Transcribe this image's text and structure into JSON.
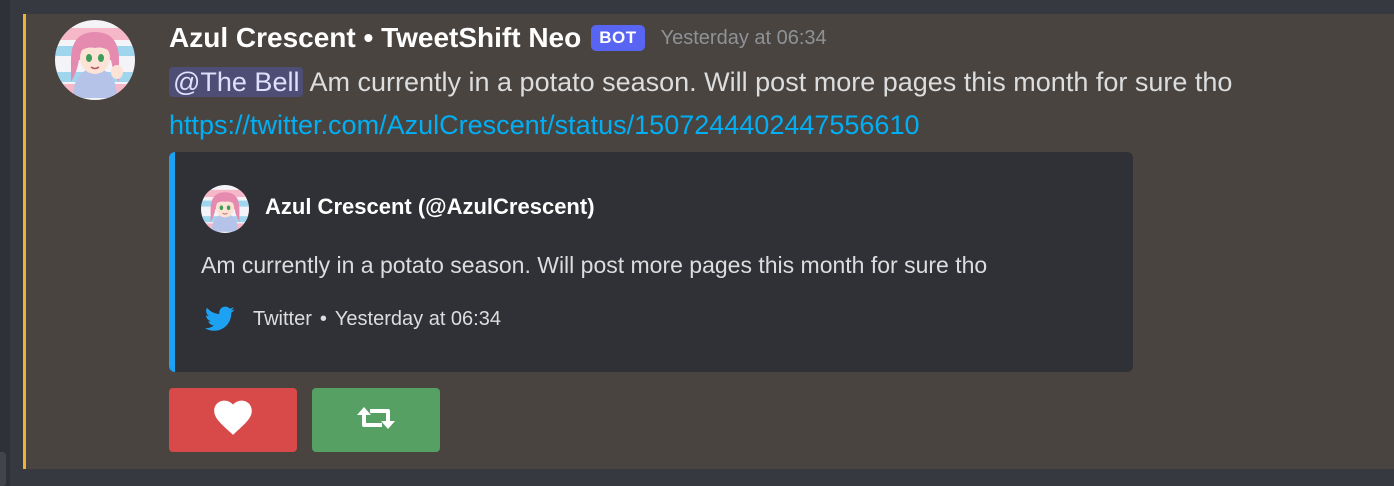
{
  "message": {
    "username": "Azul Crescent • TweetShift Neo",
    "bot_tag": "BOT",
    "timestamp": "Yesterday at 06:34",
    "mention": "@The Bell",
    "text": " Am currently in a potato season. Will post more pages this month for sure tho",
    "link": "https://twitter.com/AzulCrescent/status/1507244402447556610"
  },
  "embed": {
    "author": "Azul Crescent (@AzulCrescent)",
    "description": "Am currently in a potato season. Will post more pages this month for sure tho",
    "footer_source": "Twitter",
    "footer_separator": "•",
    "footer_time": "Yesterday at 06:34",
    "footer_icon": "twitter-bird-icon"
  },
  "buttons": {
    "like_icon": "heart-icon",
    "retweet_icon": "retweet-icon"
  },
  "colors": {
    "highlight": "#f0b232",
    "embed_accent": "#1da1f2",
    "bot_tag": "#5865f2",
    "link": "#00aff4",
    "like_button": "#d84a4a",
    "retweet_button": "#57a064"
  }
}
